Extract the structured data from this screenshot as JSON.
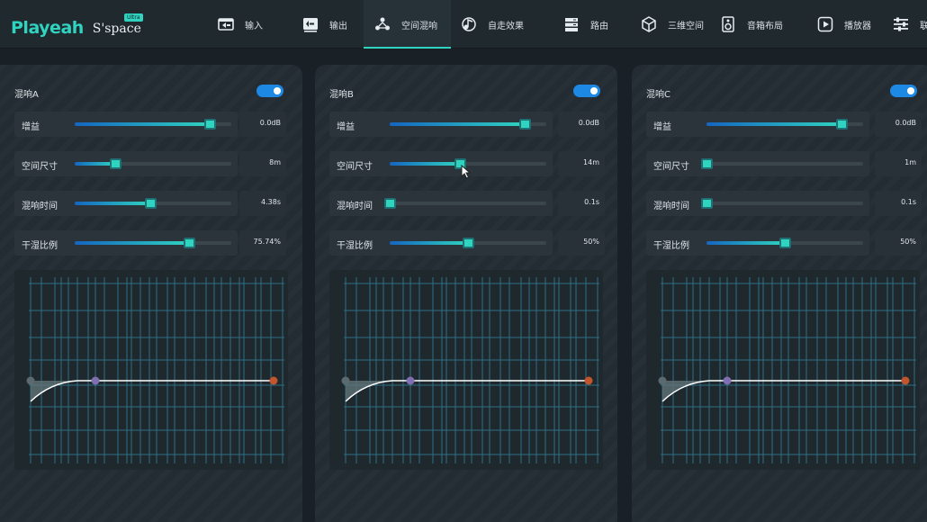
{
  "logo": {
    "main": "Playeah",
    "sub": "S'space",
    "badge": "Ultra"
  },
  "nav": {
    "items": [
      {
        "label": "输入",
        "icon": "input-icon"
      },
      {
        "label": "输出",
        "icon": "output-icon"
      },
      {
        "label": "空间混响",
        "icon": "reverb-icon",
        "active": true
      },
      {
        "label": "自走效果",
        "icon": "effect-icon"
      },
      {
        "label": "路由",
        "icon": "routing-icon"
      },
      {
        "label": "三维空间",
        "icon": "cube-icon"
      },
      {
        "label": "音箱布局",
        "icon": "speaker-icon"
      },
      {
        "label": "播放器",
        "icon": "player-icon"
      },
      {
        "label": "联",
        "icon": "sliders-icon"
      }
    ]
  },
  "panels": [
    {
      "title": "混响A",
      "enabled": true,
      "params": [
        {
          "label": "增益",
          "value": "0.0dB",
          "level": 0.86
        },
        {
          "label": "空间尺寸",
          "value": "8m",
          "level": 0.26
        },
        {
          "label": "混响时间",
          "value": "4.38s",
          "level": 0.48
        },
        {
          "label": "干湿比例",
          "value": "75.74%",
          "level": 0.73
        }
      ]
    },
    {
      "title": "混响B",
      "enabled": true,
      "params": [
        {
          "label": "增益",
          "value": "0.0dB",
          "level": 0.86
        },
        {
          "label": "空间尺寸",
          "value": "14m",
          "level": 0.45
        },
        {
          "label": "混响时间",
          "value": "0.1s",
          "level": 0.0
        },
        {
          "label": "干湿比例",
          "value": "50%",
          "level": 0.5
        }
      ]
    },
    {
      "title": "混响C",
      "enabled": true,
      "params": [
        {
          "label": "增益",
          "value": "0.0dB",
          "level": 0.86
        },
        {
          "label": "空间尺寸",
          "value": "1m",
          "level": 0.0
        },
        {
          "label": "混响时间",
          "value": "0.1s",
          "level": 0.0
        },
        {
          "label": "干湿比例",
          "value": "50%",
          "level": 0.5
        }
      ]
    }
  ],
  "colors": {
    "accent": "#2fd3c0",
    "toggle": "#1e88e5",
    "node_start": "#5a6a6f",
    "node_mid": "#7d6fb0",
    "node_end": "#c0552e"
  }
}
